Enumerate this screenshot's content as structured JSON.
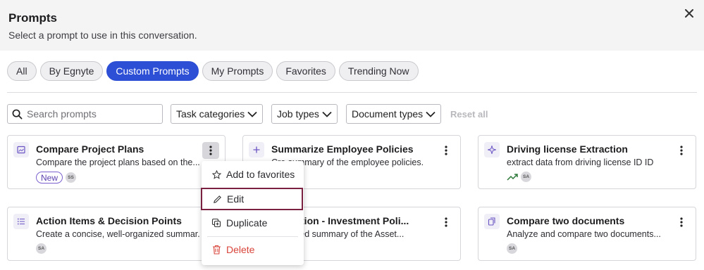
{
  "header": {
    "title": "Prompts",
    "subtitle": "Select a prompt to use in this conversation.",
    "close_glyph": "×"
  },
  "tabs": [
    {
      "label": "All",
      "active": false
    },
    {
      "label": "By Egnyte",
      "active": false
    },
    {
      "label": "Custom Prompts",
      "active": true
    },
    {
      "label": "My Prompts",
      "active": false
    },
    {
      "label": "Favorites",
      "active": false
    },
    {
      "label": "Trending Now",
      "active": false
    }
  ],
  "filters": {
    "search_placeholder": "Search prompts",
    "task_categories": "Task categories",
    "job_types": "Job types",
    "document_types": "Document types",
    "reset_all": "Reset all"
  },
  "cards": [
    {
      "title": "Compare Project Plans",
      "description": "Compare the project plans based on the...",
      "badge": "New",
      "avatar": "SS",
      "icon": "image-icon"
    },
    {
      "title": "Summarize Employee Policies",
      "description": "Cre  summary of the employee policies.",
      "avatar": "",
      "icon": "plus-icon"
    },
    {
      "title": "Driving license Extraction",
      "description": "extract data from driving license ID ID",
      "avatar": "SA",
      "icon": "sparkle-icon",
      "trending": true
    },
    {
      "title": "Action Items & Decision Points",
      "description": "Create a concise, well-organized summar...",
      "avatar": "SA",
      "icon": "list-icon"
    },
    {
      "title": "Allocation - Investment Poli...",
      "description": "a detailed summary of the Asset...",
      "avatar": "",
      "icon": "doc-icon"
    },
    {
      "title": "Compare two documents",
      "description": "Analyze and compare two documents...",
      "avatar": "SA",
      "icon": "copy-icon"
    }
  ],
  "context_menu": {
    "items": [
      {
        "label": "Add to favorites",
        "icon": "star-icon"
      },
      {
        "label": "Edit",
        "icon": "pencil-icon"
      },
      {
        "label": "Duplicate",
        "icon": "duplicate-icon"
      },
      {
        "label": "Delete",
        "icon": "trash-icon"
      }
    ]
  },
  "colors": {
    "accent": "#2d4fd6",
    "danger": "#d9443a",
    "focus_outline": "#7a2040",
    "badge_purple": "#7c62d0"
  }
}
